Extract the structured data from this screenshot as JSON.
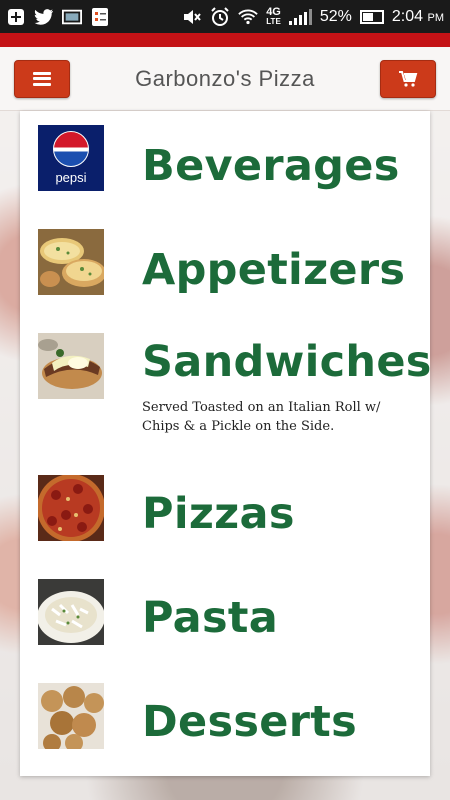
{
  "status_bar": {
    "battery_percent": "52%",
    "time": "2:04",
    "ampm": "PM",
    "network": "4G",
    "network_sub": "LTE"
  },
  "header": {
    "title": "Garbonzo's Pizza"
  },
  "menu": {
    "items": [
      {
        "name": "Beverages",
        "thumb": "pepsi-logo",
        "thumb_label": "pepsi"
      },
      {
        "name": "Appetizers",
        "thumb": "garlic-bread"
      },
      {
        "name": "Sandwiches",
        "thumb": "sandwich",
        "description": "Served Toasted on an Italian Roll w/ Chips & a Pickle on the Side."
      },
      {
        "name": "Pizzas",
        "thumb": "pizza"
      },
      {
        "name": "Pasta",
        "thumb": "pasta"
      },
      {
        "name": "Desserts",
        "thumb": "dessert-rolls"
      }
    ]
  },
  "colors": {
    "accent_red": "#c41216",
    "button_red": "#cc3a1a",
    "item_green": "#1c6b3a"
  }
}
